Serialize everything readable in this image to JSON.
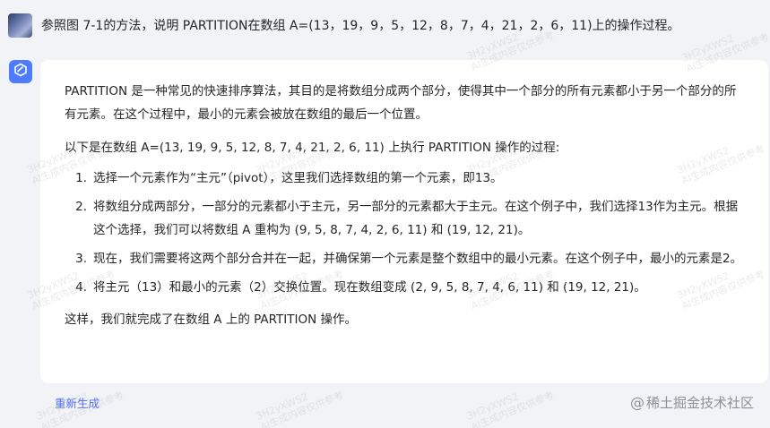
{
  "user": {
    "message": "参照图 7-1的方法，说明 PARTITION在数组 A=(13，19，9，5，12，8，7，4，21，2，6，11)上的操作过程。"
  },
  "answer": {
    "intro": "PARTITION 是一种常见的快速排序算法，其目的是将数组分成两个部分，使得其中一个部分的所有元素都小于另一个部分的所有元素。在这个过程中，最小的元素会被放在数组的最后一个位置。",
    "lead": "以下是在数组 A=(13, 19, 9, 5, 12, 8, 7, 4, 21, 2, 6, 11) 上执行 PARTITION 操作的过程:",
    "steps": [
      {
        "num": "1.",
        "text": "选择一个元素作为“主元”（pivot），这里我们选择数组的第一个元素，即13。"
      },
      {
        "num": "2.",
        "text": "将数组分成两部分，一部分的元素都小于主元，另一部分的元素都大于主元。在这个例子中，我们选择13作为主元。根据这个选择，我们可以将数组 A 重构为 (9, 5, 8, 7, 4, 2, 6, 11) 和 (19, 12, 21)。"
      },
      {
        "num": "3.",
        "text": "现在，我们需要将这两个部分合并在一起，并确保第一个元素是整个数组中的最小元素。在这个例子中，最小的元素是2。"
      },
      {
        "num": "4.",
        "text": "将主元（13）和最小的元素（2）交换位置。现在数组变成 (2, 9, 5, 8, 7, 4, 6, 11) 和 (19, 12, 21)。"
      }
    ],
    "conclusion": "这样，我们就完成了在数组 A 上的 PARTITION 操作。"
  },
  "actions": {
    "regenerate_label": "重新生成"
  },
  "watermark": {
    "badge_at": "@",
    "badge_text": "稀土掘金技术社区",
    "code": "3H2yXWS2",
    "notice": "AI生成内容仅供参考"
  },
  "icons": {
    "bot": "cube-logo-icon"
  },
  "colors": {
    "accent": "#4e6ef2",
    "bot_avatar": "#4d7cff",
    "page_bg": "#f2f3f7",
    "card_bg": "#ffffff"
  }
}
